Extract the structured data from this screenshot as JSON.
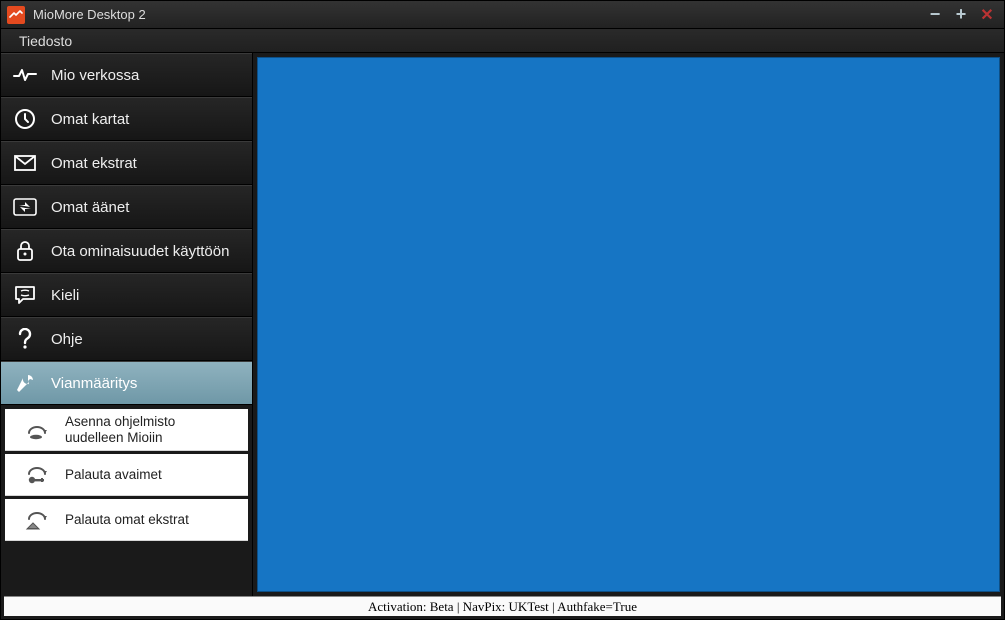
{
  "window": {
    "title": "MioMore Desktop 2"
  },
  "menubar": {
    "file": "Tiedosto"
  },
  "sidebar": {
    "items": [
      {
        "label": "Mio verkossa"
      },
      {
        "label": "Omat kartat"
      },
      {
        "label": "Omat ekstrat"
      },
      {
        "label": "Omat äänet"
      },
      {
        "label": "Ota ominaisuudet käyttöön"
      },
      {
        "label": "Kieli"
      },
      {
        "label": "Ohje"
      },
      {
        "label": "Vianmääritys"
      }
    ],
    "subitems": [
      {
        "label": "Asenna ohjelmisto uudelleen Mioiin"
      },
      {
        "label": "Palauta avaimet"
      },
      {
        "label": "Palauta omat ekstrat"
      }
    ]
  },
  "statusbar": {
    "text": "Activation: Beta  |  NavPix: UKTest  |  Authfake=True"
  },
  "colors": {
    "accent": "#e44a1f",
    "content_bg": "#1675c4",
    "selected_bg": "#7ba3b1"
  }
}
